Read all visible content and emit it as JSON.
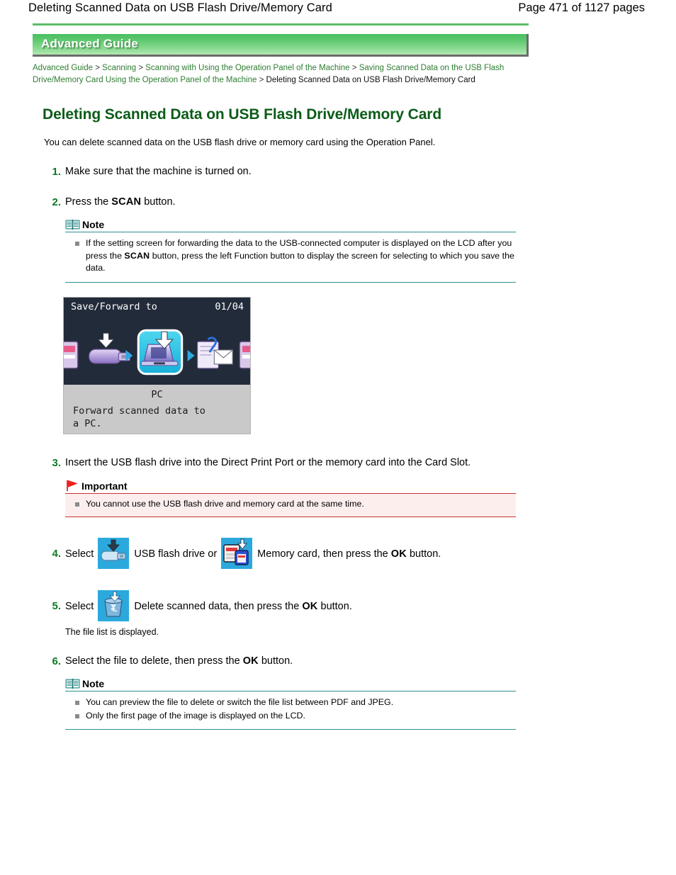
{
  "header": {
    "title": "Deleting Scanned Data on USB Flash Drive/Memory Card",
    "page_label": "Page 471 of 1127 pages"
  },
  "banner": {
    "label": "Advanced Guide"
  },
  "breadcrumb": {
    "items": [
      {
        "label": "Advanced Guide",
        "link": true
      },
      {
        "label": "Scanning",
        "link": true
      },
      {
        "label": "Scanning with Using the Operation Panel of the Machine",
        "link": true
      },
      {
        "label": "Saving Scanned Data on the USB Flash Drive/Memory Card Using the Operation Panel of the Machine",
        "link": true
      },
      {
        "label": "Deleting Scanned Data on USB Flash Drive/Memory Card",
        "link": false
      }
    ],
    "separator": ">"
  },
  "main": {
    "heading": "Deleting Scanned Data on USB Flash Drive/Memory Card",
    "intro": "You can delete scanned data on the USB flash drive or memory card using the Operation Panel.",
    "steps": [
      {
        "num": "1.",
        "text": "Make sure that the machine is turned on."
      },
      {
        "num": "2.",
        "pre": "Press the ",
        "key": "SCAN",
        "post": " button."
      },
      {
        "num": "3.",
        "text": "Insert the USB flash drive into the Direct Print Port or the memory card into the Card Slot."
      },
      {
        "num": "4.",
        "seg1": "Select",
        "seg2": "USB flash drive or",
        "seg3": "Memory card, then press the",
        "key": "OK",
        "seg4": "button."
      },
      {
        "num": "5.",
        "seg1": "Select",
        "seg2": "Delete scanned data, then press the",
        "key": "OK",
        "seg3": "button.",
        "subtext": "The file list is displayed."
      },
      {
        "num": "6.",
        "pre": "Select the file to delete, then press the ",
        "key": "OK",
        "post": " button."
      }
    ]
  },
  "note1": {
    "label": "Note",
    "icon": "open-book-icon",
    "items": [
      {
        "pre": "If the setting screen for forwarding the data to the USB-connected computer is displayed on the LCD after you press the ",
        "key": "SCAN",
        "post": " button, press the left Function button to display the screen for selecting to which you save the data."
      }
    ]
  },
  "important": {
    "label": "Important",
    "icon": "red-flag-icon",
    "items": [
      "You cannot use the USB flash drive and memory card at the same time."
    ]
  },
  "note2": {
    "label": "Note",
    "icon": "open-book-icon",
    "items": [
      "You can preview the file to delete or switch the file list between PDF and JPEG.",
      "Only the first page of the image is displayed on the LCD."
    ]
  },
  "lcd": {
    "title": "Save/Forward to",
    "counter": "01/04",
    "selected_label": "PC",
    "description_line1": "Forward scanned data to",
    "description_line2": "a PC.",
    "icons": [
      "memory-card-icon",
      "usb-flash-drive-icon",
      "pc-laptop-icon",
      "email-attachment-icon",
      "memory-card-icon"
    ]
  },
  "icons": {
    "usb_flash_drive": "usb-flash-drive-save-icon",
    "memory_card": "memory-card-save-icon",
    "delete_scanned_data": "trash-bin-icon"
  },
  "colors": {
    "accent_green": "#5cbc67",
    "heading_green": "#0b5c18",
    "link_green": "#2e7d32",
    "note_rule": "#2f8f8f",
    "important_rule": "#d03030",
    "important_bg": "#fdeeee"
  }
}
